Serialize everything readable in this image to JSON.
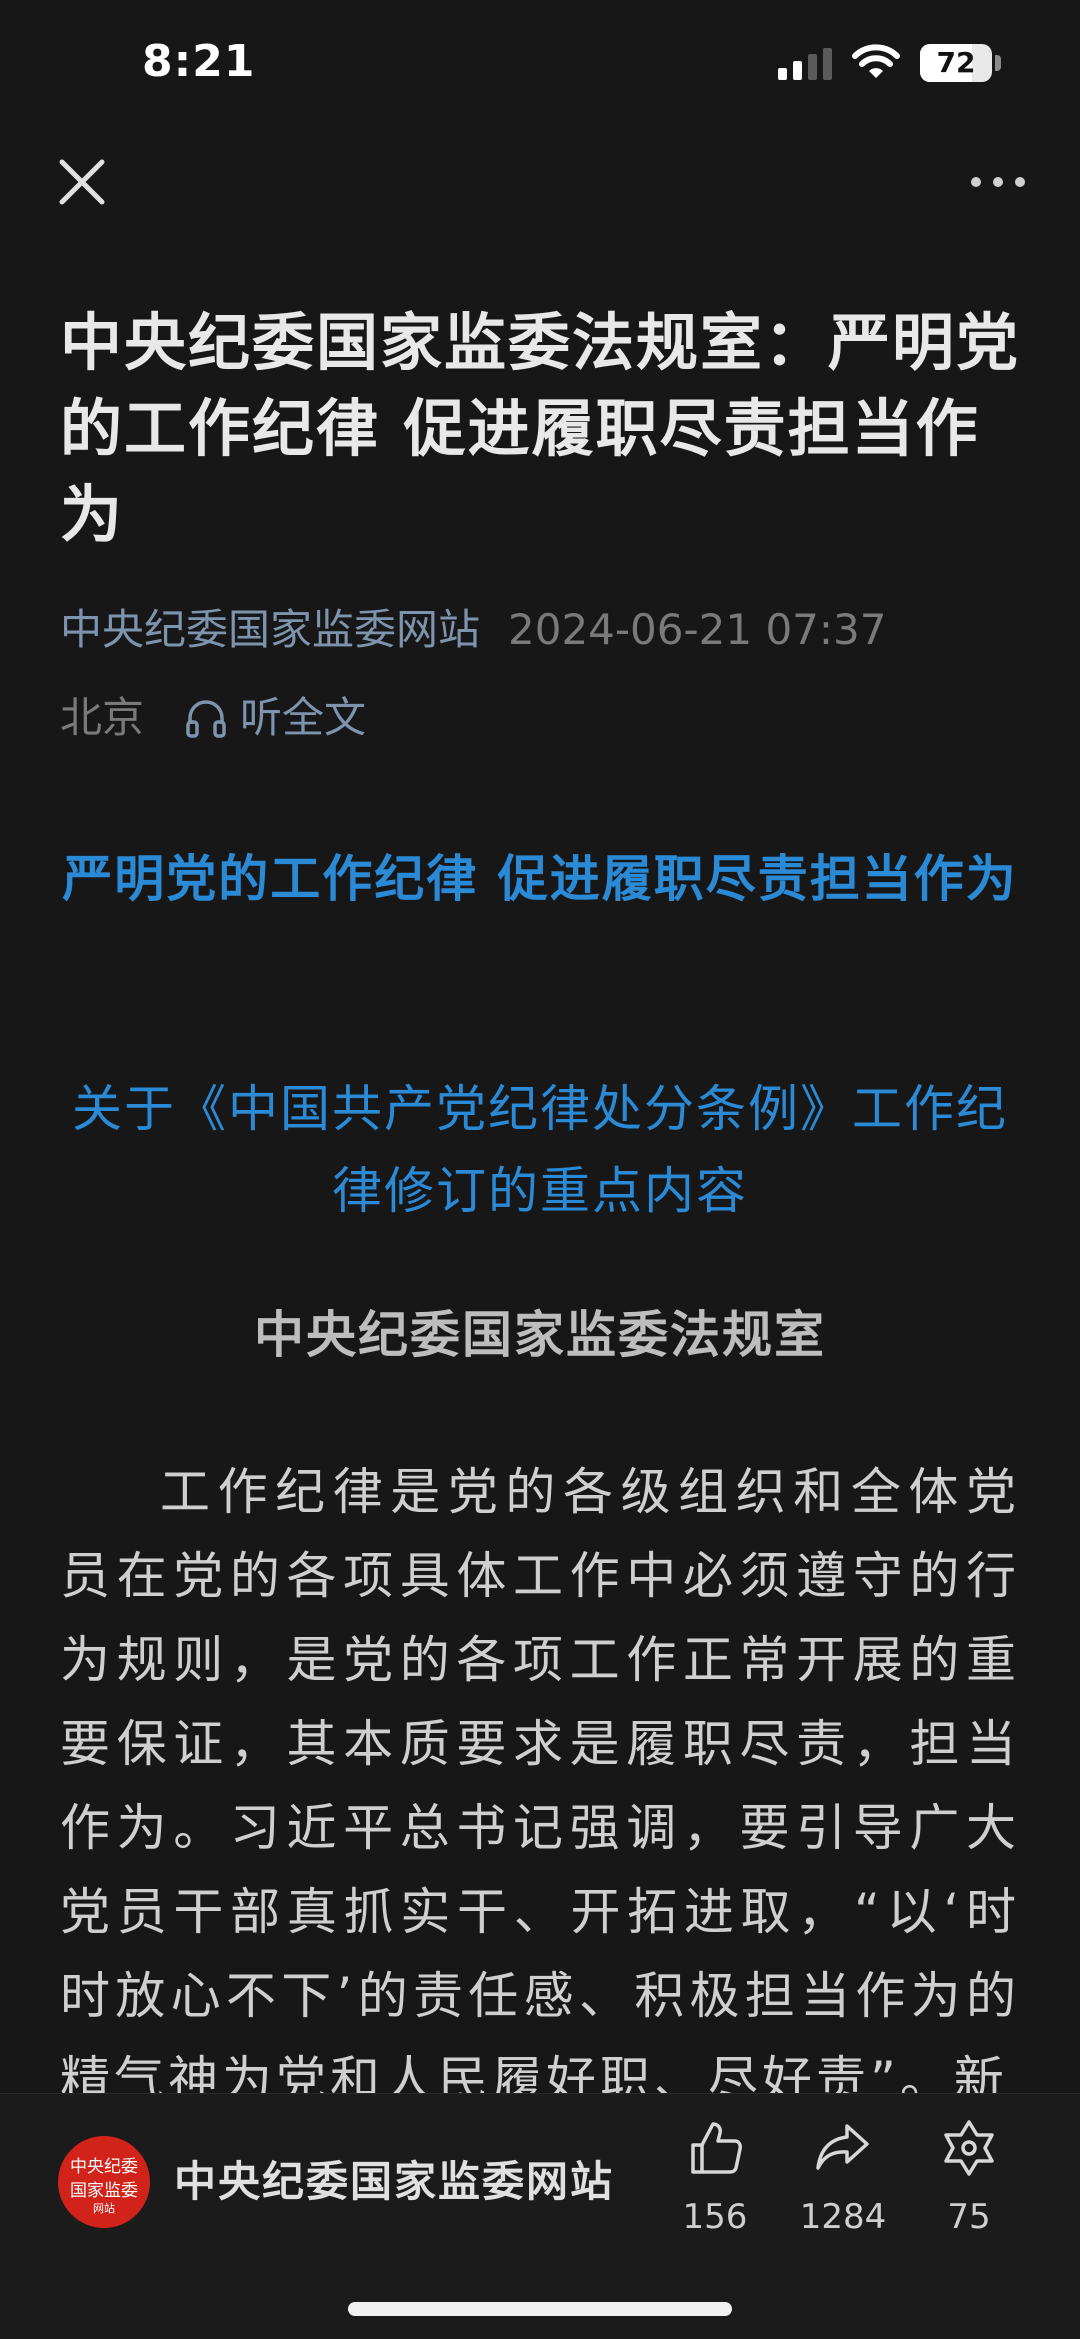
{
  "status_bar": {
    "time": "8:21",
    "battery": "72",
    "battery_level": 0.72
  },
  "nav": {
    "close_icon": "close-icon",
    "more_icon": "more-horizontal-icon"
  },
  "article": {
    "title": "中央纪委国家监委法规室：严明党的工作纪律 促进履职尽责担当作为",
    "source": "中央纪委国家监委网站",
    "datetime": "2024-06-21 07:37",
    "location": "北京",
    "listen_label": "听全文",
    "headline": "严明党的工作纪律 促进履职尽责担当作为",
    "subheadline": "关于《中国共产党纪律处分条例》工作纪律修订的重点内容",
    "author": "中央纪委国家监委法规室",
    "body": "工作纪律是党的各级组织和全体党员在党的各项具体工作中必须遵守的行为规则，是党的各项工作正常开展的重要保证，其本质要求是履职尽责，担当作为。习近平总书记强调，要引导广大党员干部真抓实干、开拓进取，“以‘时时放心不下’的责任感、积极担当作为的精气神为党和人民履好职、尽好责”。新"
  },
  "bottom_bar": {
    "publisher_name": "中央纪委国家监委网站",
    "logo_line1": "中央纪委",
    "logo_line2": "国家监委",
    "logo_line3": "网站",
    "likes": "156",
    "shares": "1284",
    "favorites": "75"
  },
  "colors": {
    "accent_blue": "#2a8ad6",
    "meta_blue": "#7e93ad",
    "logo_red": "#d1231a",
    "background": "#171717"
  }
}
